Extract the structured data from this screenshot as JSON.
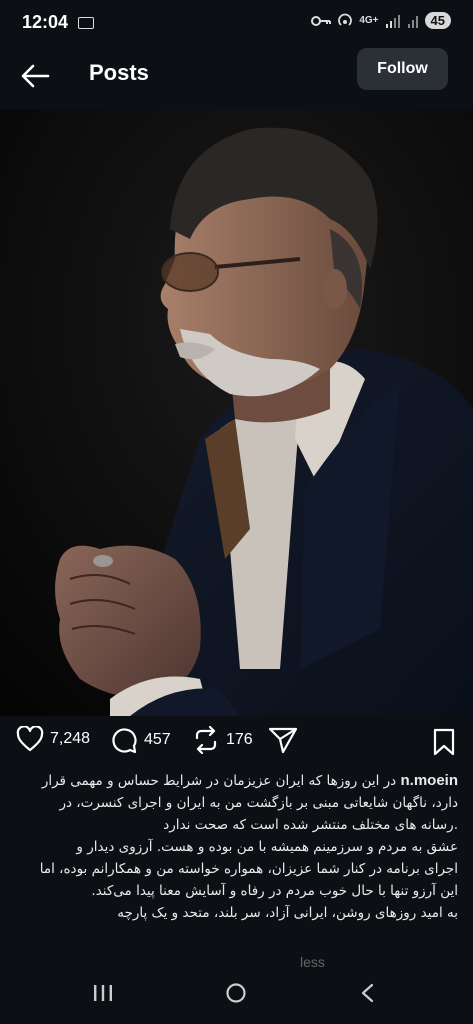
{
  "status_bar": {
    "time": "12:04",
    "network": "4G+",
    "battery": "45"
  },
  "header": {
    "title": "Posts",
    "follow_label": "Follow"
  },
  "post": {
    "likes": "7,248",
    "comments": "457",
    "reposts": "176",
    "username": "n.moein",
    "caption_lines": [
      "در این روزها که ایران عزیزمان در شرایط حساس و مهمی قرار",
      "دارد، ناگهان شایعاتی مبنی بر بازگشت من به ایران و اجرای کنسرت، در",
      ".رسانه های مختلف منتشر شده است که صحت ندارد",
      "عشق به مردم و سرزمینم همیشه با من بوده و هست. آرزوی دیدار و",
      "اجرای برنامه در کنار شما عزیزان، همواره خواسته من و همکارانم بوده، اما",
      "این آرزو تنها با حال خوب مردم در رفاه و آسایش معنا پیدا می‌کند.",
      "به امید روزهای روشن، ایرانی آزاد، سر بلند، متحد و یک پارچه"
    ],
    "more_text": "less"
  },
  "icons": {
    "back": "arrow-left-icon",
    "like": "heart-icon",
    "comment": "comment-icon",
    "repost": "repost-icon",
    "share": "send-icon",
    "save": "bookmark-icon"
  }
}
